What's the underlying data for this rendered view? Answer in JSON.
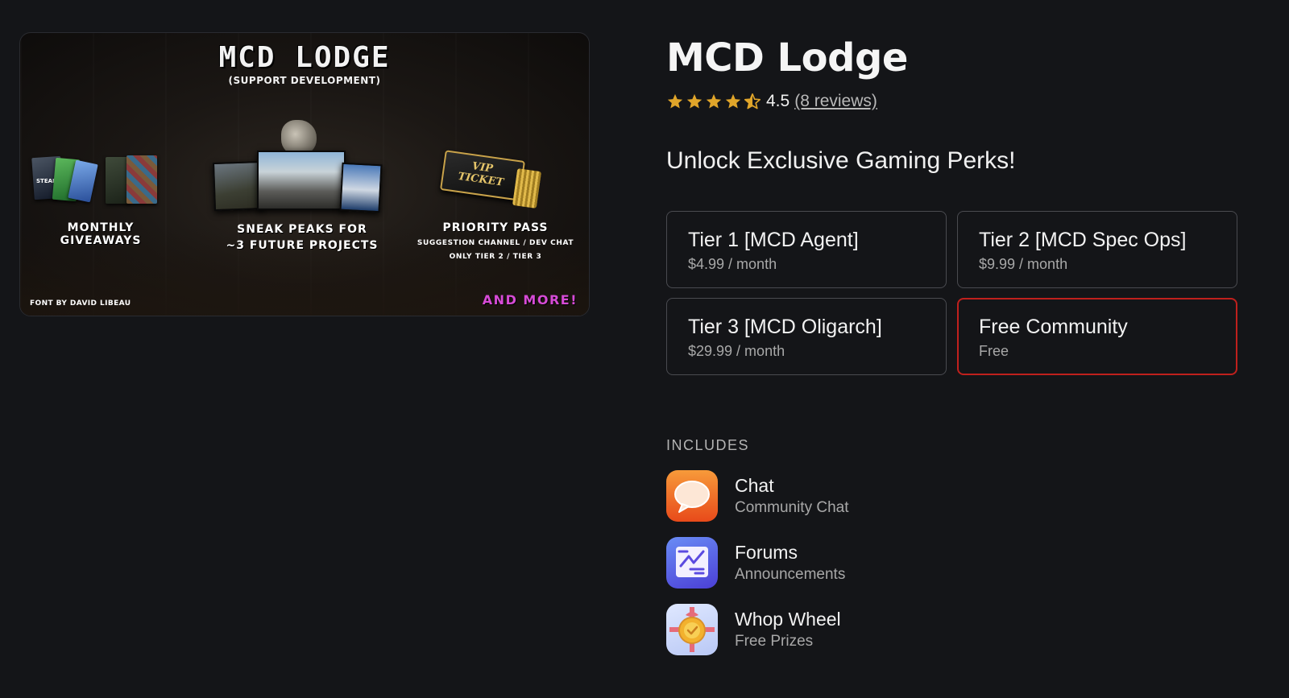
{
  "banner": {
    "title": "MCD LODGE",
    "subtitle": "(SUPPORT DEVELOPMENT)",
    "caption_giveaways": "MONTHLY GIVEAWAYS",
    "caption_sneak_1": "SNEAK PEAKS FOR",
    "caption_sneak_2": "~3 FUTURE PROJECTS",
    "caption_priority": "PRIORITY PASS",
    "priority_line_1": "SUGGESTION CHANNEL / DEV CHAT",
    "priority_line_2": "ONLY TIER 2 / TIER 3",
    "font_credit": "FONT BY DAVID LIBEAU",
    "and_more": "AND MORE!",
    "steam_label": "STEAM",
    "ticket_text_1": "VIP",
    "ticket_text_2": "TICKET"
  },
  "product": {
    "title": "MCD Lodge",
    "rating_value": "4.5",
    "rating_stars": 4.5,
    "reviews_link": "(8 reviews)",
    "tagline": "Unlock Exclusive Gaming Perks!"
  },
  "tiers": [
    {
      "name": "Tier 1 [MCD Agent]",
      "price": "$4.99 / month",
      "selected": false
    },
    {
      "name": "Tier 2 [MCD Spec Ops]",
      "price": "$9.99 / month",
      "selected": false
    },
    {
      "name": "Tier 3 [MCD Oligarch]",
      "price": "$29.99 / month",
      "selected": false
    },
    {
      "name": "Free Community",
      "price": "Free",
      "selected": true
    }
  ],
  "includes": {
    "heading": "INCLUDES",
    "items": [
      {
        "name": "Chat",
        "description": "Community Chat",
        "icon": "chat-bubble-icon"
      },
      {
        "name": "Forums",
        "description": "Announcements",
        "icon": "forums-icon"
      },
      {
        "name": "Whop Wheel",
        "description": "Free Prizes",
        "icon": "prize-wheel-icon"
      }
    ]
  },
  "colors": {
    "background": "#141518",
    "star": "#e0a52a",
    "selected_border": "#c0201d",
    "card_border": "#4a4b50"
  }
}
